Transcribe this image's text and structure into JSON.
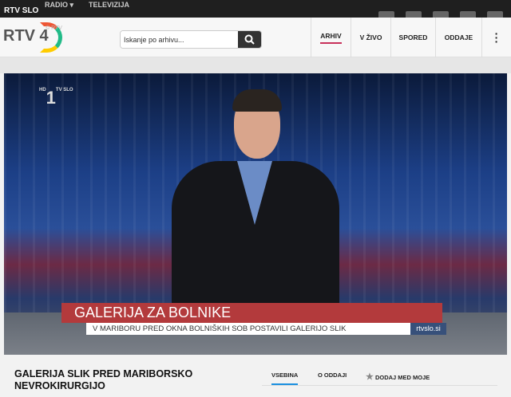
{
  "topbar": {
    "brand": "RTV SLO",
    "menu": [
      "RADIO",
      "TELEVIZIJA"
    ]
  },
  "header": {
    "logo": "RTV 4",
    "logo_sub": "© RTV",
    "search_placeholder": "Iskanje po arhivu...",
    "nav": [
      "ARHIV",
      "V ŽIVO",
      "SPORED",
      "ODDAJE"
    ],
    "active_nav": "ARHIV"
  },
  "video": {
    "channel": "1",
    "channel_hd": "HD",
    "channel_sub": "TV SLO",
    "headline": "GALERIJA ZA BOLNIKE",
    "subline": "V MARIBORU PRED OKNA BOLNIŠKIH SOB POSTAVILI GALERIJO SLIK",
    "source": "rtvslo.si"
  },
  "content": {
    "title": "GALERIJA SLIK PRED MARIBORSKO NEVROKIRURGIJO",
    "tabs": [
      "VSEBINA",
      "O ODDAJI",
      "DODAJ MED MOJE"
    ]
  }
}
